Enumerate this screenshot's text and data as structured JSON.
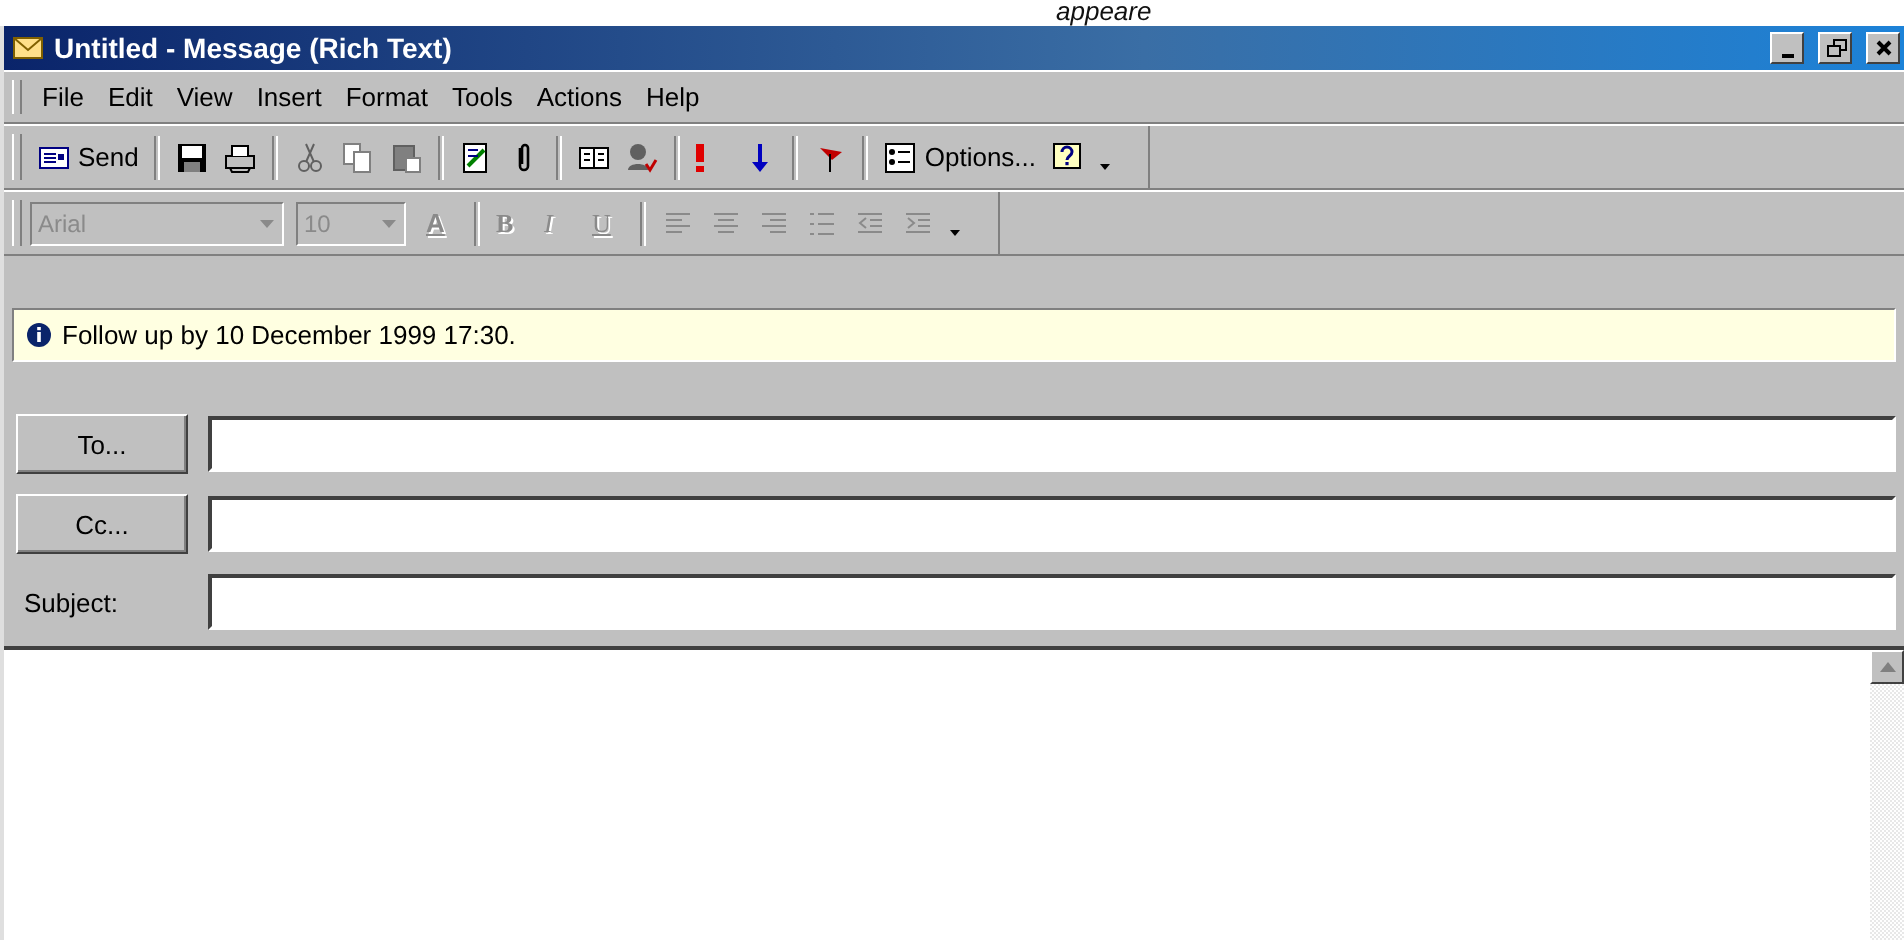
{
  "caption": "appeare",
  "window": {
    "title": "Untitled - Message (Rich Text)",
    "controls": [
      {
        "kind": "minimize"
      },
      {
        "kind": "restore"
      },
      {
        "kind": "close"
      }
    ]
  },
  "menu": [
    "File",
    "Edit",
    "View",
    "Insert",
    "Format",
    "Tools",
    "Actions",
    "Help"
  ],
  "standard_toolbar": [
    {
      "kind": "send",
      "label": "Send"
    },
    {
      "kind": "separator"
    },
    {
      "kind": "save"
    },
    {
      "kind": "print"
    },
    {
      "kind": "separator"
    },
    {
      "kind": "cut"
    },
    {
      "kind": "copy"
    },
    {
      "kind": "paste"
    },
    {
      "kind": "separator"
    },
    {
      "kind": "check"
    },
    {
      "kind": "attach"
    },
    {
      "kind": "separator"
    },
    {
      "kind": "book"
    },
    {
      "kind": "names"
    },
    {
      "kind": "separator"
    },
    {
      "kind": "high"
    },
    {
      "kind": "low"
    },
    {
      "kind": "separator"
    },
    {
      "kind": "flag"
    },
    {
      "kind": "separator"
    },
    {
      "kind": "options",
      "label": "Options..."
    },
    {
      "kind": "help"
    },
    {
      "kind": "more"
    }
  ],
  "format_toolbar": {
    "disabled": true,
    "font": "Arial",
    "size": "10",
    "items": [
      {
        "kind": "color",
        "label": "A"
      },
      {
        "kind": "separator"
      },
      {
        "kind": "bold",
        "label": "B"
      },
      {
        "kind": "italic",
        "label": "I"
      },
      {
        "kind": "underline",
        "label": "U"
      },
      {
        "kind": "separator"
      },
      {
        "kind": "left"
      },
      {
        "kind": "center"
      },
      {
        "kind": "right"
      },
      {
        "kind": "bullets"
      },
      {
        "kind": "outdent"
      },
      {
        "kind": "indent"
      },
      {
        "kind": "more"
      }
    ]
  },
  "info_bar": {
    "text": "Follow up by 10 December 1999 17:30."
  },
  "fields": [
    {
      "kind": "button",
      "label": "To..."
    },
    {
      "kind": "button",
      "label": "Cc..."
    },
    {
      "kind": "label",
      "label": "Subject:"
    }
  ]
}
